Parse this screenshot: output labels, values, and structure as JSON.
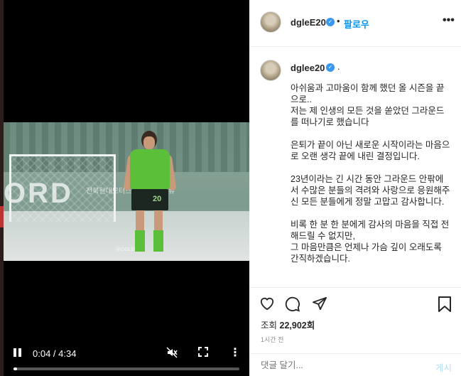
{
  "video": {
    "banner_text": "ORD",
    "watermark": "전북현대모터스 선수단 인터뷰",
    "watermark_small": "@DGLEE20",
    "player_number": "20",
    "current_time": "0:04",
    "duration": "4:34",
    "time_display": "0:04 / 4:34",
    "progress_fraction": 0.015,
    "icons": {
      "play": "pause-icon",
      "mute": "muted-speaker-icon",
      "fullscreen": "fullscreen-icon",
      "more": "vertical-ellipsis-icon"
    }
  },
  "header": {
    "username": "dgleE20",
    "separator": "•",
    "follow_label": "팔로우",
    "more_label": "•••"
  },
  "caption": {
    "username": "dglee20",
    "suffix": ".",
    "paragraphs": [
      "아쉬움과 고마움이 함께 했던 올 시즌을 끝으로..\n저는 제 인생의 모든 것을 쏟았던 그라운드를 떠나기로 했습니다",
      "은퇴가 끝이 아닌 새로운 시작이라는 마음으로 오랜 생각 끝에 내린 결정입니다.",
      "23년이라는 긴 시간 동안 그라운드 안팎에서 수많은 분들의 격려와 사랑으로 응원해주신 모든 분들에게 정말 고맙고 감사합니다.",
      "비록 한 분 한 분에게 감사의 마음을 직접 전해드릴 수 없지만,\n그 마음만큼은 언제나 가슴 깊이 오래도록 간직하겠습니다."
    ]
  },
  "actions": {
    "views_label": "조회",
    "views_count": "22,902회",
    "time_ago": "1시간 전",
    "comment_placeholder": "댓글 달기...",
    "post_label": "게시"
  },
  "colors": {
    "accent": "#0095f6",
    "verified": "#3897f0",
    "text": "#262626",
    "muted": "#8e8e8e"
  }
}
